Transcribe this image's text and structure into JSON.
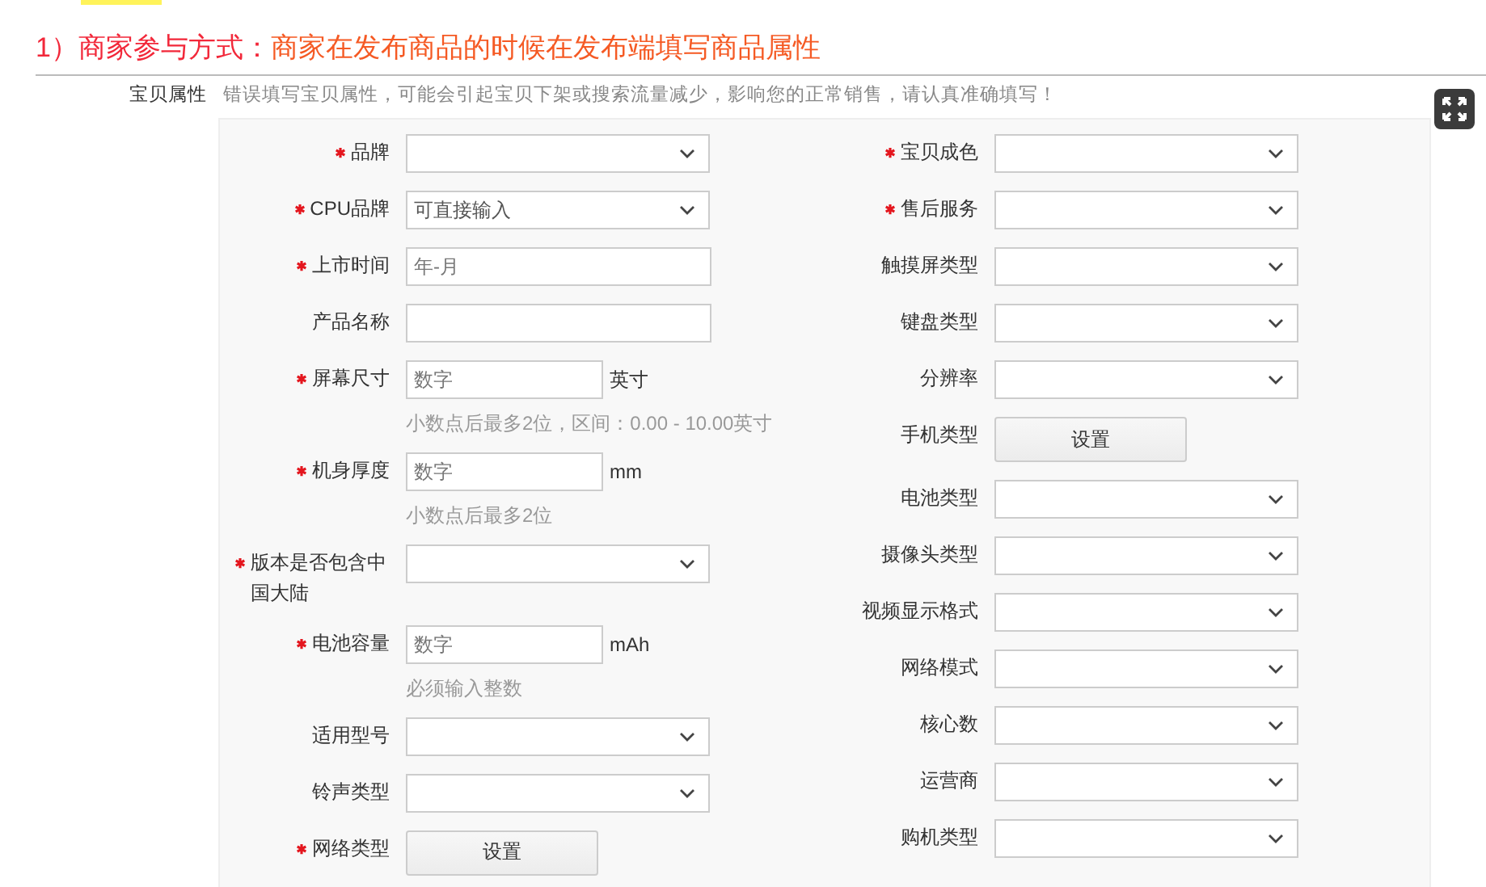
{
  "heading": {
    "label": "1）商家参与方式：",
    "text": "商家在发布商品的时候在发布端填写商品属性"
  },
  "section": {
    "title": "宝贝属性",
    "note": "错误填写宝贝属性，可能会引起宝贝下架或搜索流量减少，影响您的正常销售，请认真准确填写！"
  },
  "left_fields": [
    {
      "label": "品牌",
      "required": true,
      "kind": "select"
    },
    {
      "label": "CPU品牌",
      "required": true,
      "kind": "combo",
      "placeholder": "可直接输入"
    },
    {
      "label": "上市时间",
      "required": true,
      "kind": "input",
      "placeholder": "年-月"
    },
    {
      "label": "产品名称",
      "required": false,
      "kind": "input"
    },
    {
      "label": "屏幕尺寸",
      "required": true,
      "kind": "unit_input",
      "placeholder": "数字",
      "unit": "英寸",
      "hint": "小数点后最多2位，区间：0.00 - 10.00英寸"
    },
    {
      "label": "机身厚度",
      "required": true,
      "kind": "unit_input",
      "placeholder": "数字",
      "unit": "mm",
      "hint": "小数点后最多2位"
    },
    {
      "label": "版本是否包含中国大陆",
      "required": true,
      "kind": "select"
    },
    {
      "label": "电池容量",
      "required": true,
      "kind": "unit_input",
      "placeholder": "数字",
      "unit": "mAh",
      "hint": "必须输入整数"
    },
    {
      "label": "适用型号",
      "required": false,
      "kind": "select"
    },
    {
      "label": "铃声类型",
      "required": false,
      "kind": "select"
    },
    {
      "label": "网络类型",
      "required": true,
      "kind": "button",
      "button_label": "设置"
    }
  ],
  "right_fields": [
    {
      "label": "宝贝成色",
      "required": true,
      "kind": "select"
    },
    {
      "label": "售后服务",
      "required": true,
      "kind": "select"
    },
    {
      "label": "触摸屏类型",
      "required": false,
      "kind": "select"
    },
    {
      "label": "键盘类型",
      "required": false,
      "kind": "select"
    },
    {
      "label": "分辨率",
      "required": false,
      "kind": "select"
    },
    {
      "label": "手机类型",
      "required": false,
      "kind": "button",
      "button_label": "设置"
    },
    {
      "label": "电池类型",
      "required": false,
      "kind": "select"
    },
    {
      "label": "摄像头类型",
      "required": false,
      "kind": "select"
    },
    {
      "label": "视频显示格式",
      "required": false,
      "kind": "select"
    },
    {
      "label": "网络模式",
      "required": false,
      "kind": "select"
    },
    {
      "label": "核心数",
      "required": false,
      "kind": "select"
    },
    {
      "label": "运营商",
      "required": false,
      "kind": "select"
    },
    {
      "label": "购机类型",
      "required": false,
      "kind": "select"
    }
  ]
}
